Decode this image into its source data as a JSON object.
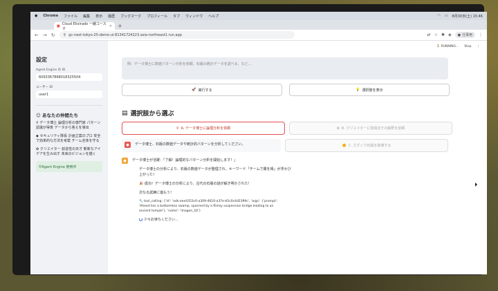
{
  "menubar": {
    "app": "Chrome",
    "items": [
      "ファイル",
      "編集",
      "表示",
      "履歴",
      "ブックマーク",
      "プロフィール",
      "タブ",
      "ウィンドウ",
      "ヘルプ"
    ],
    "clock": "8月30日(土) 15:46"
  },
  "tab": {
    "title": "Cloud Elixirado 一緒コースマ"
  },
  "url": "gc-next-tokyo-25-demo-ui-81341724223.asia-northeast1.run.app",
  "profile": "仕事用",
  "topright": {
    "status": "RUNNING...",
    "stop": "Stop"
  },
  "sidebar": {
    "title": "設定",
    "engine_label": "Agent Engine の ID",
    "engine_id": "6093367868018325504",
    "user_label": "ユーザー ID",
    "user_id": "user1",
    "team_title": "あなたの仲間たち",
    "members": [
      "データ博士 論理分析の専門家 パターン認識が得意 データから答えを導出",
      "セキュリティ隊長 計画立案のプロ 安全で効率的な方法を考案 チーム全体を守る",
      "クリエイター 創造性の天才 斬新なアイデアを生み出す 未来のビジョンを描く"
    ],
    "status": "Agent Engine 使用中"
  },
  "main": {
    "placeholder": "例：データ博士に数値パターン分析を依頼、石版の統計データを調べる、など...",
    "run_button": "実行する",
    "show_button": "選択肢を表示",
    "section_title": "選択肢から選ぶ",
    "choice_a": "A. データ博士に論理分析を依頼",
    "choice_b": "B. クリエイターに別視点での解釈を依頼",
    "choice_c": "C. 力ずくで石版を破壊する",
    "user_message": "データ博士、石版の数値データや統計的パターンを分析してください。",
    "agent_line1": "データ博士が活躍：「了解！論理的なパターン分析を開始します！」",
    "agent_line2": "データ博士の分析により、石版の数値データが整理され、キーワード「チームで霧を晴」が浮かび上がった！",
    "agent_line3": "成功！データ博士の分析により、古代の石版の謎が解き明かされた！",
    "agent_line4": "次なる試練に進もう！",
    "tool_call": "tool_calling: {'id': 'adk-aee4353c0-a309-4610-a37e-b5c0c4d2399c', 'args': {'prompt': 'Ahead lies a bottomless swamp, spanned by a flimsy suspension bridge leading to an ancient temple'}, 'name': 'imagen_t2i'}",
    "waiting": "少々お待ちください..."
  }
}
